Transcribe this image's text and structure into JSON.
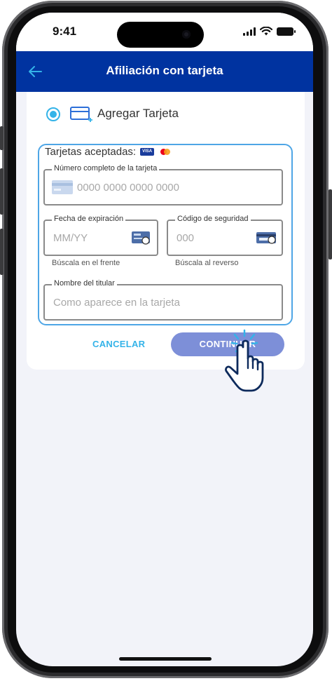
{
  "status_bar": {
    "time": "9:41"
  },
  "app_bar": {
    "title": "Afiliación con tarjeta",
    "back_icon": "arrow-left-icon"
  },
  "add_card": {
    "label": "Agregar Tarjeta",
    "selected": true
  },
  "accepted_cards": {
    "label": "Tarjetas aceptadas:",
    "brands": [
      "visa-icon",
      "mastercard-icon"
    ]
  },
  "form": {
    "card_number": {
      "label": "Número completo de la tarjeta",
      "placeholder": "0000 0000 0000 0000"
    },
    "expiry": {
      "label": "Fecha de expiración",
      "placeholder": "MM/YY",
      "hint": "Búscala en el frente"
    },
    "security_code": {
      "label": "Código de seguridad",
      "placeholder": "000",
      "hint": "Búscala al reverso"
    },
    "holder_name": {
      "label": "Nombre del titular",
      "placeholder": "Como aparece en la tarjeta"
    }
  },
  "actions": {
    "cancel_label": "CANCELAR",
    "continue_label": "CONTINUAR"
  },
  "colors": {
    "primary": "#0033a0",
    "accent": "#34b3e8",
    "border_active": "#4ea6e6",
    "button_bg": "#7d8fd8"
  }
}
